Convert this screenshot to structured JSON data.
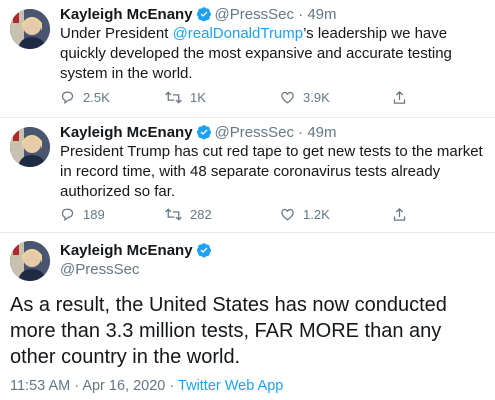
{
  "tweets": [
    {
      "name": "Kayleigh McEnany",
      "handle": "@PressSec",
      "dot": "·",
      "time": "49m",
      "text_before": "Under President ",
      "mention": "@realDonaldTrump",
      "text_after": "’s leadership we have quickly developed the most expansive and accurate testing system in the world.",
      "replies": "2.5K",
      "retweets": "1K",
      "likes": "3.9K"
    },
    {
      "name": "Kayleigh McEnany",
      "handle": "@PressSec",
      "dot": "·",
      "time": "49m",
      "text": "President Trump has cut red tape to get new tests to the market in record time, with 48 separate coronavirus tests already authorized so far.",
      "replies": "189",
      "retweets": "282",
      "likes": "1.2K"
    }
  ],
  "main_tweet": {
    "name": "Kayleigh McEnany",
    "handle": "@PressSec",
    "text": "As a result, the United States has now conducted more than 3.3 million tests, FAR MORE than any other country in the world.",
    "time": "11:53 AM",
    "date": "Apr 16, 2020",
    "dot": "·",
    "app": "Twitter Web App"
  },
  "icons": {
    "reply": "reply-icon",
    "retweet": "retweet-icon",
    "like": "heart-icon",
    "share": "share-icon",
    "verified": "verified-badge-icon"
  },
  "colors": {
    "accent": "#1da1f2",
    "text": "#14171a",
    "muted": "#657786"
  }
}
